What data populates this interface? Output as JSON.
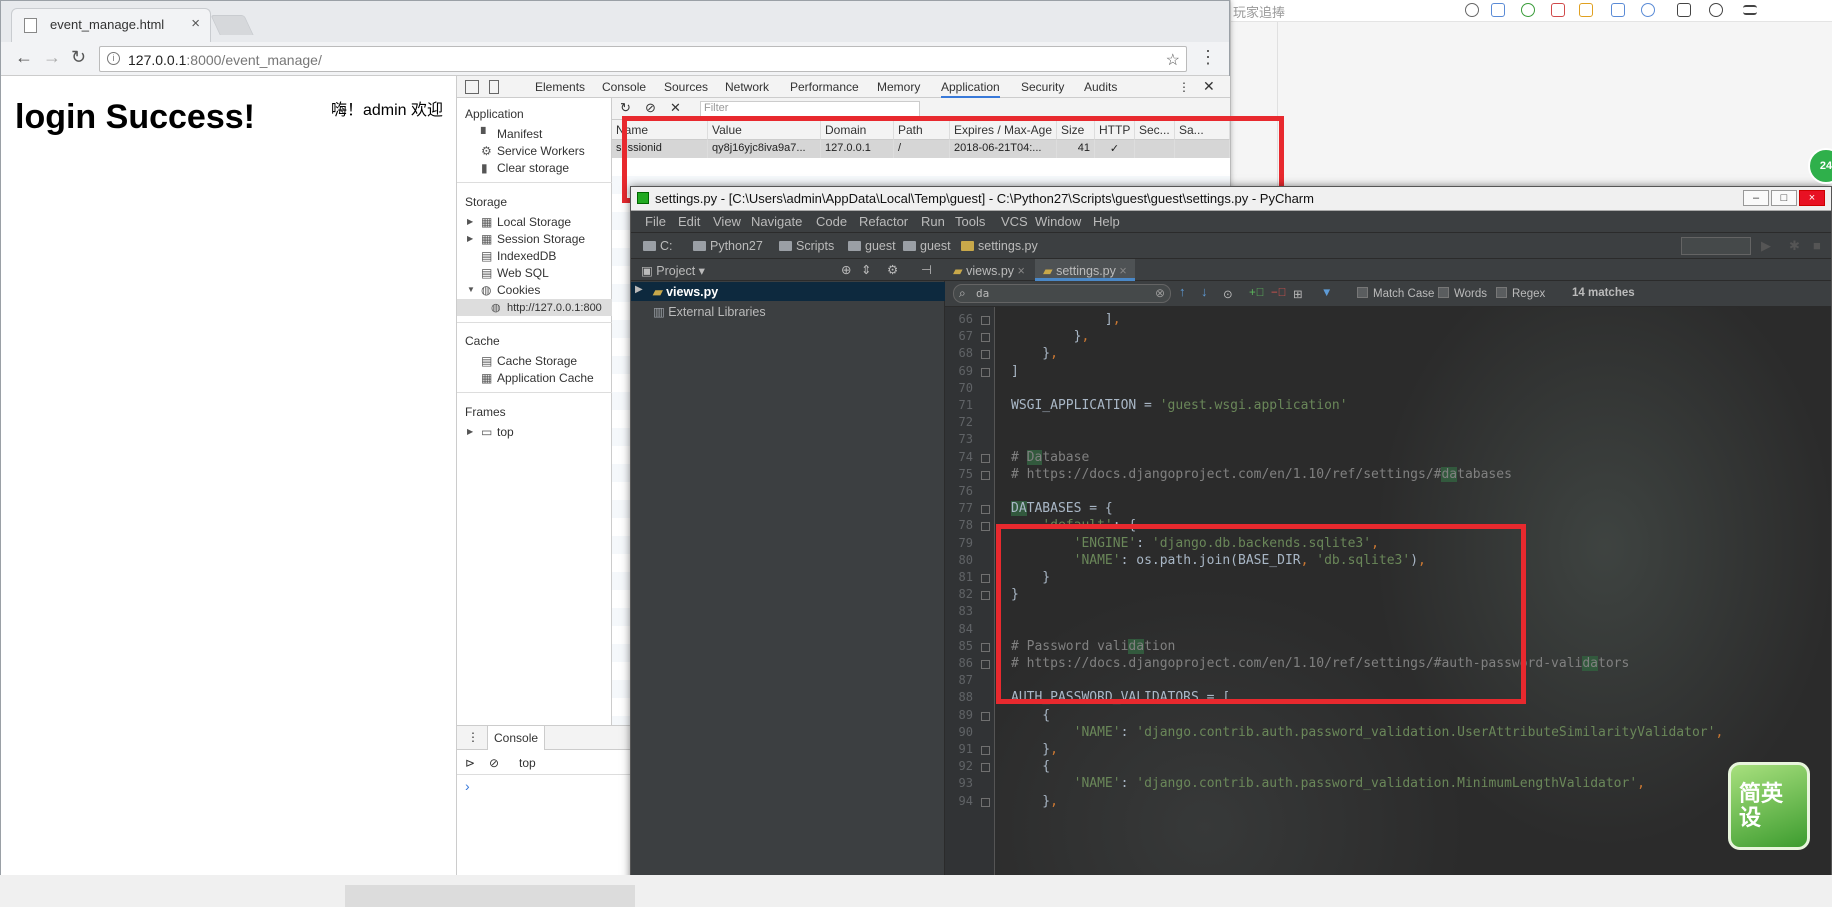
{
  "background_app": {
    "search_placeholder": "玩家追捧"
  },
  "browser": {
    "tab_title": "event_manage.html",
    "url_host": "127.0.0.1",
    "url_rest": ":8000/event_manage/"
  },
  "page": {
    "heading": "login Success!",
    "welcome": "嗨！admin 欢迎"
  },
  "devtools": {
    "tabs": [
      "Elements",
      "Console",
      "Sources",
      "Network",
      "Performance",
      "Memory",
      "Application",
      "Security",
      "Audits"
    ],
    "filter_placeholder": "Filter",
    "sections": {
      "application": "Application",
      "storage": "Storage",
      "cache": "Cache",
      "frames": "Frames"
    },
    "app_items": [
      "Manifest",
      "Service Workers",
      "Clear storage"
    ],
    "storage_items": [
      "Local Storage",
      "Session Storage",
      "IndexedDB",
      "Web SQL",
      "Cookies"
    ],
    "cookie_origin": "http://127.0.0.1:800",
    "cache_items": [
      "Cache Storage",
      "Application Cache"
    ],
    "frames_items": [
      "top"
    ],
    "cookie_columns": [
      "Name",
      "Value",
      "Domain",
      "Path",
      "Expires / Max-Age",
      "Size",
      "HTTP",
      "Sec...",
      "Sa..."
    ],
    "cookie_row": [
      "sessionid",
      "qy8j16yjc8iva9a7...",
      "127.0.0.1",
      "/",
      "2018-06-21T04:...",
      "41",
      "✓",
      "",
      ""
    ],
    "drawer_tab": "Console",
    "drawer_context": "top",
    "drawer_prompt": "›"
  },
  "pycharm": {
    "title": "settings.py - [C:\\Users\\admin\\AppData\\Local\\Temp\\guest] - C:\\Python27\\Scripts\\guest\\guest\\settings.py - PyCharm",
    "menu": [
      "File",
      "Edit",
      "View",
      "Navigate",
      "Code",
      "Refactor",
      "Run",
      "Tools",
      "VCS",
      "Window",
      "Help"
    ],
    "breadcrumbs": [
      "C:",
      "Python27",
      "Scripts",
      "guest",
      "guest",
      "settings.py"
    ],
    "project_label": "Project",
    "project_items": [
      "views.py",
      "External Libraries"
    ],
    "editor_tabs": [
      "views.py",
      "settings.py"
    ],
    "search_text": "da",
    "search_options": [
      "Match Case",
      "Words",
      "Regex"
    ],
    "matches": "14 matches",
    "line_numbers": [
      "66",
      "67",
      "68",
      "69",
      "70",
      "71",
      "72",
      "73",
      "74",
      "75",
      "76",
      "77",
      "78",
      "79",
      "80",
      "81",
      "82",
      "83",
      "84",
      "85",
      "86",
      "87",
      "88",
      "89",
      "90",
      "91",
      "92",
      "93",
      "94"
    ],
    "code_lines": [
      "            ],",
      "        },",
      "    },",
      "]",
      "",
      "WSGI_APPLICATION = 'guest.wsgi.application'",
      "",
      "",
      "# Database",
      "# https://docs.djangoproject.com/en/1.10/ref/settings/#databases",
      "",
      "DATABASES = {",
      "    'default': {",
      "        'ENGINE': 'django.db.backends.sqlite3',",
      "        'NAME': os.path.join(BASE_DIR, 'db.sqlite3'),",
      "    }",
      "}",
      "",
      "",
      "# Password validation",
      "# https://docs.djangoproject.com/en/1.10/ref/settings/#auth-password-validators",
      "",
      "AUTH_PASSWORD_VALIDATORS = [",
      "    {",
      "        'NAME': 'django.contrib.auth.password_validation.UserAttributeSimilarityValidator',",
      "    },",
      "    {",
      "        'NAME': 'django.contrib.auth.password_validation.MinimumLengthValidator',",
      "    },"
    ]
  },
  "widgets": {
    "green_circle": "24",
    "badge_text": "简英设"
  }
}
